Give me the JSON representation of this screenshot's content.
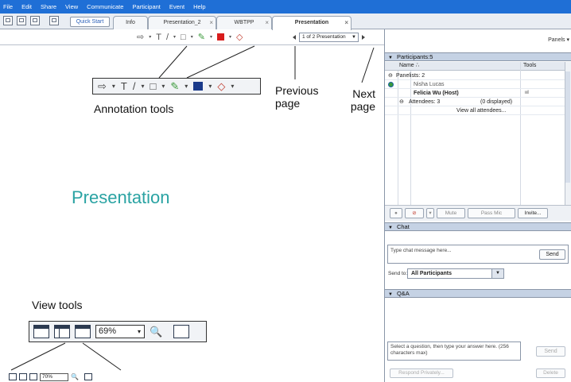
{
  "menu": [
    "File",
    "Edit",
    "Share",
    "View",
    "Communicate",
    "Participant",
    "Event",
    "Help"
  ],
  "tabs": {
    "quick_start": "Quick Start",
    "items": [
      {
        "label": "Info",
        "closable": false
      },
      {
        "label": "Presentation_2",
        "closable": true
      },
      {
        "label": "WBTPP",
        "closable": true
      },
      {
        "label": "Presentation",
        "closable": true,
        "active": true
      }
    ],
    "close_glyph": "×"
  },
  "annotation_toolbar": {
    "pointer": "⇨",
    "text": "T",
    "line": "/",
    "rect": "□",
    "pen": "✎",
    "eraser": "◇",
    "dropdown": "▾"
  },
  "pager": {
    "label": "1 of 2 Presentation",
    "dropdown": "▼"
  },
  "callouts": {
    "annotation_tools": "Annotation tools",
    "previous_page": "Previous\npage",
    "next_page": "Next\npage",
    "view_tools": "View tools"
  },
  "presentation_title": "Presentation",
  "view_tools": {
    "zoom": "69%",
    "zoom_small": "70%",
    "dropdown": "▾",
    "magnifier": "🔍"
  },
  "panels_button": "Panels ▾",
  "participants": {
    "header": "Participants:5",
    "col_name": "Name ∴",
    "col_tools": "Tools",
    "panelists_group": "Panelists: 2",
    "panelists": [
      {
        "name": "Nisha Lucas",
        "bold": false,
        "tool": ""
      },
      {
        "name": "Felicia Wu (Host)",
        "bold": true,
        "tool": "ııl"
      }
    ],
    "attendees_group": "Attendees: 3",
    "attendees_count": "(0 displayed)",
    "view_all": "View all attendees..."
  },
  "participant_toolbar": {
    "mute": "Mute",
    "pass_mic": "Pass Mic",
    "invite": "Invite..."
  },
  "chat": {
    "header": "Chat",
    "placeholder": "Type chat message here...",
    "send": "Send",
    "send_to_label": "Send to:",
    "send_to_value": "All Participants"
  },
  "qa": {
    "header": "Q&A",
    "placeholder": "Select a question, then type your answer here. (256 characters max)",
    "send": "Send",
    "respond_privately": "Respond Privately...",
    "delete": "Delete"
  },
  "colors": {
    "menubar": "#1f6fd6",
    "title": "#2aa3a3",
    "panel_header": "#c5d2e4"
  }
}
